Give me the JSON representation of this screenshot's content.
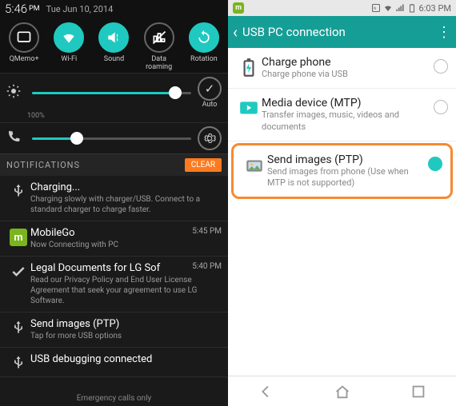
{
  "left": {
    "status": {
      "time": "5:46",
      "ampm": "PM",
      "date": "Tue Jun 10, 2014"
    },
    "toggles": [
      {
        "label": "QMemo+",
        "on": false,
        "icon": "qmemo"
      },
      {
        "label": "Wi-Fi",
        "on": true,
        "icon": "wifi"
      },
      {
        "label": "Sound",
        "on": true,
        "icon": "sound"
      },
      {
        "label": "Data roaming",
        "on": false,
        "icon": "roam"
      },
      {
        "label": "Rotation",
        "on": true,
        "icon": "rotate"
      }
    ],
    "brightness": {
      "value": 90,
      "auto_label": "Auto",
      "pct_label": "100%"
    },
    "volume": {
      "value": 28
    },
    "notif_header": "NOTIFICATIONS",
    "clear": "CLEAR",
    "notifs": [
      {
        "icon": "usb",
        "title": "Charging...",
        "desc": "Charging slowly with charger/USB. Connect to a standard charger to charge faster.",
        "time": ""
      },
      {
        "icon": "mobilego",
        "title": "MobileGo",
        "desc": "Now Connecting with PC",
        "time": "5:45 PM"
      },
      {
        "icon": "check",
        "title": "Legal Documents for LG Sof",
        "desc": "Read our Privacy Policy and End User License Agreement that seek your agreement to use LG Software.",
        "time": "5:40 PM"
      },
      {
        "icon": "usb",
        "title": "Send images (PTP)",
        "desc": "Tap for more USB options",
        "time": ""
      },
      {
        "icon": "usb",
        "title": "USB debugging connected",
        "desc": "",
        "time": ""
      }
    ],
    "footer": "Emergency calls only"
  },
  "right": {
    "status_time": "6:03 PM",
    "header": "USB PC connection",
    "options": [
      {
        "title": "Charge phone",
        "desc": "Charge phone via USB",
        "selected": false,
        "hl": false
      },
      {
        "title": "Media device (MTP)",
        "desc": "Transfer images, music, videos and documents",
        "selected": false,
        "hl": false
      },
      {
        "title": "Send images (PTP)",
        "desc": "Send images from phone (Use when MTP is not supported)",
        "selected": true,
        "hl": true
      }
    ]
  }
}
